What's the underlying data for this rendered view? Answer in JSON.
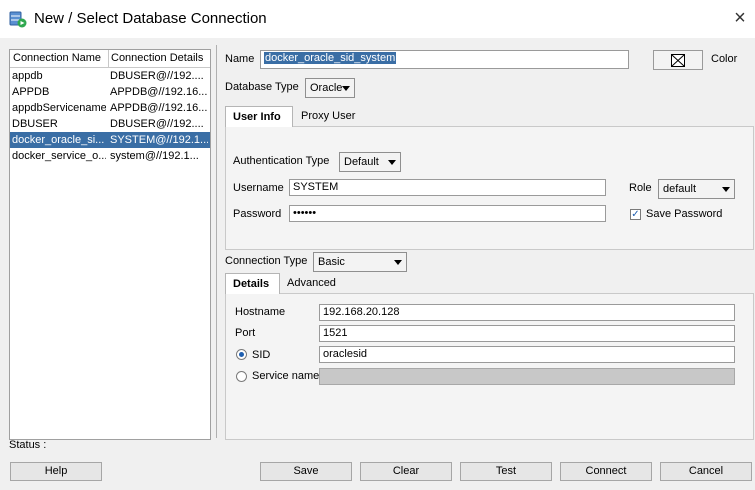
{
  "window": {
    "title": "New / Select Database Connection",
    "icon": "database-connect-icon",
    "close": "×"
  },
  "connections": {
    "headers": [
      "Connection Name",
      "Connection Details"
    ],
    "rows": [
      {
        "name": "appdb",
        "details": "DBUSER@//192....",
        "selected": false
      },
      {
        "name": "APPDB",
        "details": "APPDB@//192.16...",
        "selected": false
      },
      {
        "name": "appdbServicename",
        "details": "APPDB@//192.16...",
        "selected": false
      },
      {
        "name": "DBUSER",
        "details": "DBUSER@//192....",
        "selected": false
      },
      {
        "name": "docker_oracle_si...",
        "details": "SYSTEM@//192.1...",
        "selected": true
      },
      {
        "name": "docker_service_o...",
        "details": "system@//192.1...",
        "selected": false
      }
    ]
  },
  "form": {
    "name_label": "Name",
    "name_value": "docker_oracle_sid_system",
    "color_label": "Color",
    "db_type_label": "Database Type",
    "db_type_value": "Oracle",
    "tabs": {
      "user_info": "User Info",
      "proxy_user": "Proxy User"
    },
    "auth_type_label": "Authentication Type",
    "auth_type_value": "Default",
    "username_label": "Username",
    "username_value": "SYSTEM",
    "password_label": "Password",
    "password_value": "••••••",
    "role_label": "Role",
    "role_value": "default",
    "save_password_label": "Save Password",
    "save_password_checked": true,
    "conn_type_label": "Connection Type",
    "conn_type_value": "Basic",
    "detail_tabs": {
      "details": "Details",
      "advanced": "Advanced"
    },
    "hostname_label": "Hostname",
    "hostname_value": "192.168.20.128",
    "port_label": "Port",
    "port_value": "1521",
    "sid_label": "SID",
    "sid_value": "oraclesid",
    "service_name_label": "Service name",
    "service_name_value": ""
  },
  "status_label": "Status :",
  "buttons": {
    "help": "Help",
    "save": "Save",
    "clear": "Clear",
    "test": "Test",
    "connect": "Connect",
    "cancel": "Cancel"
  },
  "colors": {
    "selection": "#3a6ea5",
    "accent": "#1f5fb0"
  }
}
